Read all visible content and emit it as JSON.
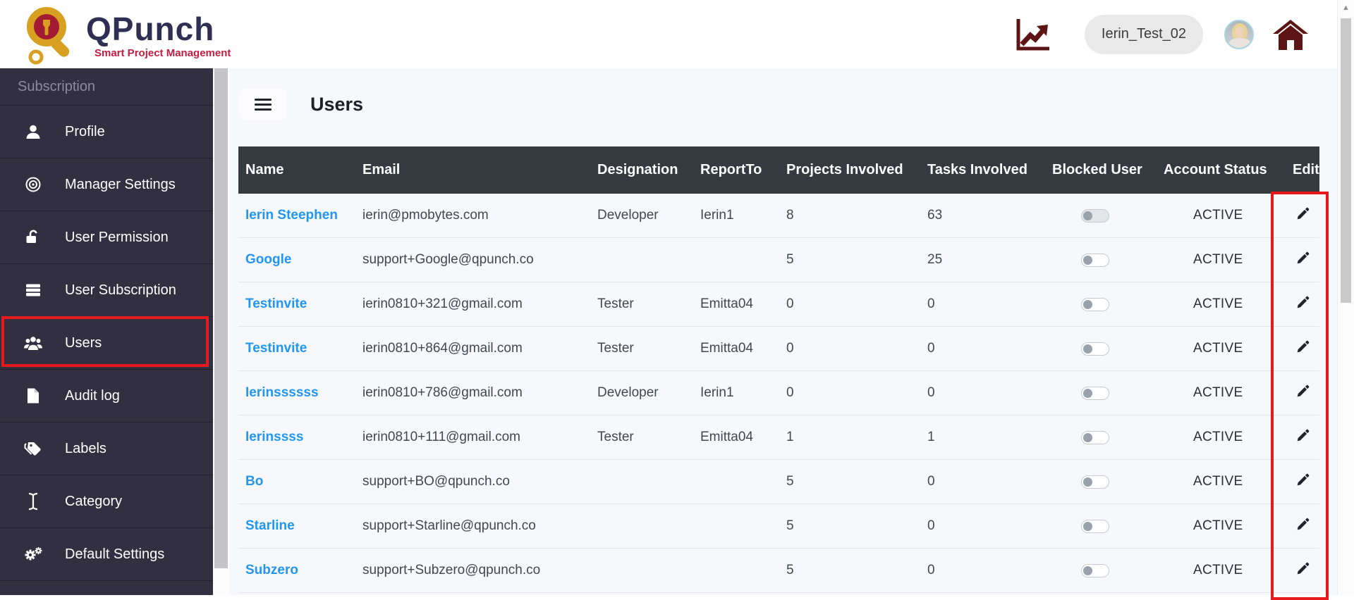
{
  "topbar": {
    "logo": {
      "title": "QPunch",
      "subtitle": "Smart Project Management"
    },
    "workspace_label": "Ierin_Test_02"
  },
  "page": {
    "title": "Users"
  },
  "sidebar": {
    "section_label": "Subscription",
    "items": [
      {
        "label": "Profile",
        "icon": "user-icon",
        "active": false
      },
      {
        "label": "Manager Settings",
        "icon": "disc-icon",
        "active": false
      },
      {
        "label": "User Permission",
        "icon": "unlock-icon",
        "active": false
      },
      {
        "label": "User Subscription",
        "icon": "server-icon",
        "active": false
      },
      {
        "label": "Users",
        "icon": "users-icon",
        "active": true
      },
      {
        "label": "Audit log",
        "icon": "file-icon",
        "active": false
      },
      {
        "label": "Labels",
        "icon": "tags-icon",
        "active": false
      },
      {
        "label": "Category",
        "icon": "text-cursor-icon",
        "active": false
      },
      {
        "label": "Default Settings",
        "icon": "gears-icon",
        "active": false
      }
    ]
  },
  "table": {
    "columns": [
      "Name",
      "Email",
      "Designation",
      "ReportTo",
      "Projects Involved",
      "Tasks Involved",
      "Blocked User",
      "Account Status",
      "Edit"
    ],
    "rows": [
      {
        "name": "Ierin Steephen",
        "email": "ierin@pmobytes.com",
        "designation": "Developer",
        "report_to": "Ierin1",
        "projects": "8",
        "tasks": "63",
        "blocked": false,
        "status": "ACTIVE"
      },
      {
        "name": "Google",
        "email": "support+Google@qpunch.co",
        "designation": "",
        "report_to": "",
        "projects": "5",
        "tasks": "25",
        "blocked": false,
        "status": "ACTIVE"
      },
      {
        "name": "Testinvite",
        "email": "ierin0810+321@gmail.com",
        "designation": "Tester",
        "report_to": "Emitta04",
        "projects": "0",
        "tasks": "0",
        "blocked": false,
        "status": "ACTIVE"
      },
      {
        "name": "Testinvite",
        "email": "ierin0810+864@gmail.com",
        "designation": "Tester",
        "report_to": "Emitta04",
        "projects": "0",
        "tasks": "0",
        "blocked": false,
        "status": "ACTIVE"
      },
      {
        "name": "Ierinssssss",
        "email": "ierin0810+786@gmail.com",
        "designation": "Developer",
        "report_to": "Ierin1",
        "projects": "0",
        "tasks": "0",
        "blocked": false,
        "status": "ACTIVE"
      },
      {
        "name": "Ierinssss",
        "email": "ierin0810+111@gmail.com",
        "designation": "Tester",
        "report_to": "Emitta04",
        "projects": "1",
        "tasks": "1",
        "blocked": false,
        "status": "ACTIVE"
      },
      {
        "name": "Bo",
        "email": "support+BO@qpunch.co",
        "designation": "",
        "report_to": "",
        "projects": "5",
        "tasks": "0",
        "blocked": false,
        "status": "ACTIVE"
      },
      {
        "name": "Starline",
        "email": "support+Starline@qpunch.co",
        "designation": "",
        "report_to": "",
        "projects": "5",
        "tasks": "0",
        "blocked": false,
        "status": "ACTIVE"
      },
      {
        "name": "Subzero",
        "email": "support+Subzero@qpunch.co",
        "designation": "",
        "report_to": "",
        "projects": "5",
        "tasks": "0",
        "blocked": false,
        "status": "ACTIVE"
      }
    ]
  },
  "colors": {
    "sidebar_bg": "#322f40",
    "table_header_bg": "#343a40",
    "link_blue": "#2196f3",
    "highlight_red": "#e8191d",
    "icon_maroon": "#5c1414",
    "logo_navy": "#302e52",
    "logo_crimson": "#c41d41",
    "logo_gold": "#d7a021",
    "content_bg": "#f7f8fc"
  }
}
